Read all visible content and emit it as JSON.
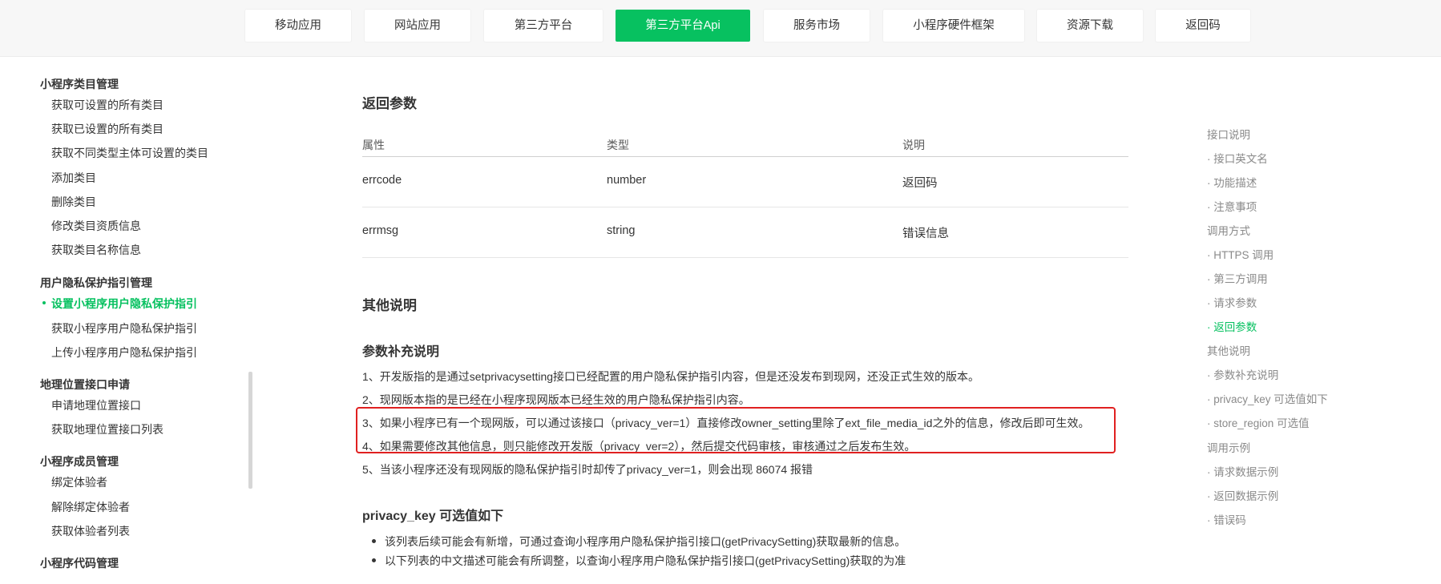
{
  "topnav": {
    "tabs": [
      {
        "label": "移动应用"
      },
      {
        "label": "网站应用"
      },
      {
        "label": "第三方平台"
      },
      {
        "label": "第三方平台Api"
      },
      {
        "label": "服务市场"
      },
      {
        "label": "小程序硬件框架"
      },
      {
        "label": "资源下载"
      },
      {
        "label": "返回码"
      }
    ]
  },
  "sidebar": {
    "groups": [
      {
        "title": "小程序类目管理",
        "items": [
          "获取可设置的所有类目",
          "获取已设置的所有类目",
          "获取不同类型主体可设置的类目",
          "添加类目",
          "删除类目",
          "修改类目资质信息",
          "获取类目名称信息"
        ]
      },
      {
        "title": "用户隐私保护指引管理",
        "items": [
          "设置小程序用户隐私保护指引",
          "获取小程序用户隐私保护指引",
          "上传小程序用户隐私保护指引"
        ]
      },
      {
        "title": "地理位置接口申请",
        "items": [
          "申请地理位置接口",
          "获取地理位置接口列表"
        ]
      },
      {
        "title": "小程序成员管理",
        "items": [
          "绑定体验者",
          "解除绑定体验者",
          "获取体验者列表"
        ]
      },
      {
        "title": "小程序代码管理",
        "items": []
      }
    ],
    "active_item": "设置小程序用户隐私保护指引"
  },
  "main": {
    "return_params_title": "返回参数",
    "table": {
      "headers": [
        "属性",
        "类型",
        "说明"
      ],
      "rows": [
        [
          "errcode",
          "number",
          "返回码"
        ],
        [
          "errmsg",
          "string",
          "错误信息"
        ]
      ]
    },
    "other_title": "其他说明",
    "supplement_title": "参数补充说明",
    "notes": [
      "1、开发版指的是通过setprivacysetting接口已经配置的用户隐私保护指引内容，但是还没发布到现网，还没正式生效的版本。",
      "2、现网版本指的是已经在小程序现网版本已经生效的用户隐私保护指引内容。",
      "3、如果小程序已有一个现网版，可以通过该接口（privacy_ver=1）直接修改owner_setting里除了ext_file_media_id之外的信息，修改后即可生效。",
      "4、如果需要修改其他信息，则只能修改开发版（privacy_ver=2），然后提交代码审核，审核通过之后发布生效。",
      "5、当该小程序还没有现网版的隐私保护指引时却传了privacy_ver=1，则会出现 86074 报错"
    ],
    "privacy_key_title": "privacy_key 可选值如下",
    "bullets": [
      "该列表后续可能会有新增，可通过查询小程序用户隐私保护指引接口(getPrivacySetting)获取最新的信息。",
      "以下列表的中文描述可能会有所调整，以查询小程序用户隐私保护指引接口(getPrivacySetting)获取的为准"
    ]
  },
  "toc": {
    "items": [
      {
        "label": "接口说明",
        "level": 1
      },
      {
        "label": "接口英文名",
        "level": 2
      },
      {
        "label": "功能描述",
        "level": 2
      },
      {
        "label": "注意事项",
        "level": 2
      },
      {
        "label": "调用方式",
        "level": 1
      },
      {
        "label": "HTTPS 调用",
        "level": 2
      },
      {
        "label": "第三方调用",
        "level": 2
      },
      {
        "label": "请求参数",
        "level": 2
      },
      {
        "label": "返回参数",
        "level": 2
      },
      {
        "label": "其他说明",
        "level": 1
      },
      {
        "label": "参数补充说明",
        "level": 2
      },
      {
        "label": "privacy_key 可选值如下",
        "level": 2
      },
      {
        "label": "store_region 可选值",
        "level": 2
      },
      {
        "label": "调用示例",
        "level": 1
      },
      {
        "label": "请求数据示例",
        "level": 2
      },
      {
        "label": "返回数据示例",
        "level": 2
      },
      {
        "label": "错误码",
        "level": 2
      }
    ],
    "active": "返回参数"
  },
  "colors": {
    "accent": "#07c160",
    "highlight": "#e02020",
    "nav_bg": "#f7f7f7"
  }
}
